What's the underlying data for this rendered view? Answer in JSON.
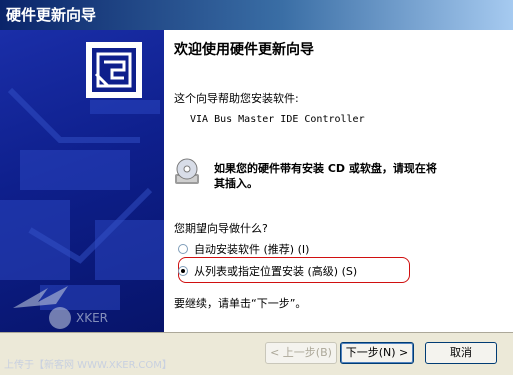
{
  "window": {
    "title": "硬件更新向导"
  },
  "content": {
    "heading": "欢迎使用硬件更新向导",
    "intro": "这个向导帮助您安装软件:",
    "device_name": "VIA Bus Master IDE Controller",
    "cd_hint_line1": "如果您的硬件带有安装 CD 或软盘，请现在将",
    "cd_hint_line2": "其插入。",
    "question": "您期望向导做什么?",
    "options": [
      {
        "label": "自动安装软件 (推荐) (I)",
        "selected": false
      },
      {
        "label": "从列表或指定位置安装 (高级) (S)",
        "selected": true
      }
    ],
    "continue_text": "要继续，请单击“下一步”。"
  },
  "buttons": {
    "back_label": "< 上一步(B)",
    "next_label": "下一步(N) >",
    "cancel_label": "取消"
  },
  "watermark": "上传于【新客网 WWW.XKER.COM】",
  "colors": {
    "title_gradient_start": "#0a246a",
    "left_panel": "#0e1f8c",
    "highlight_border": "#d01010"
  }
}
